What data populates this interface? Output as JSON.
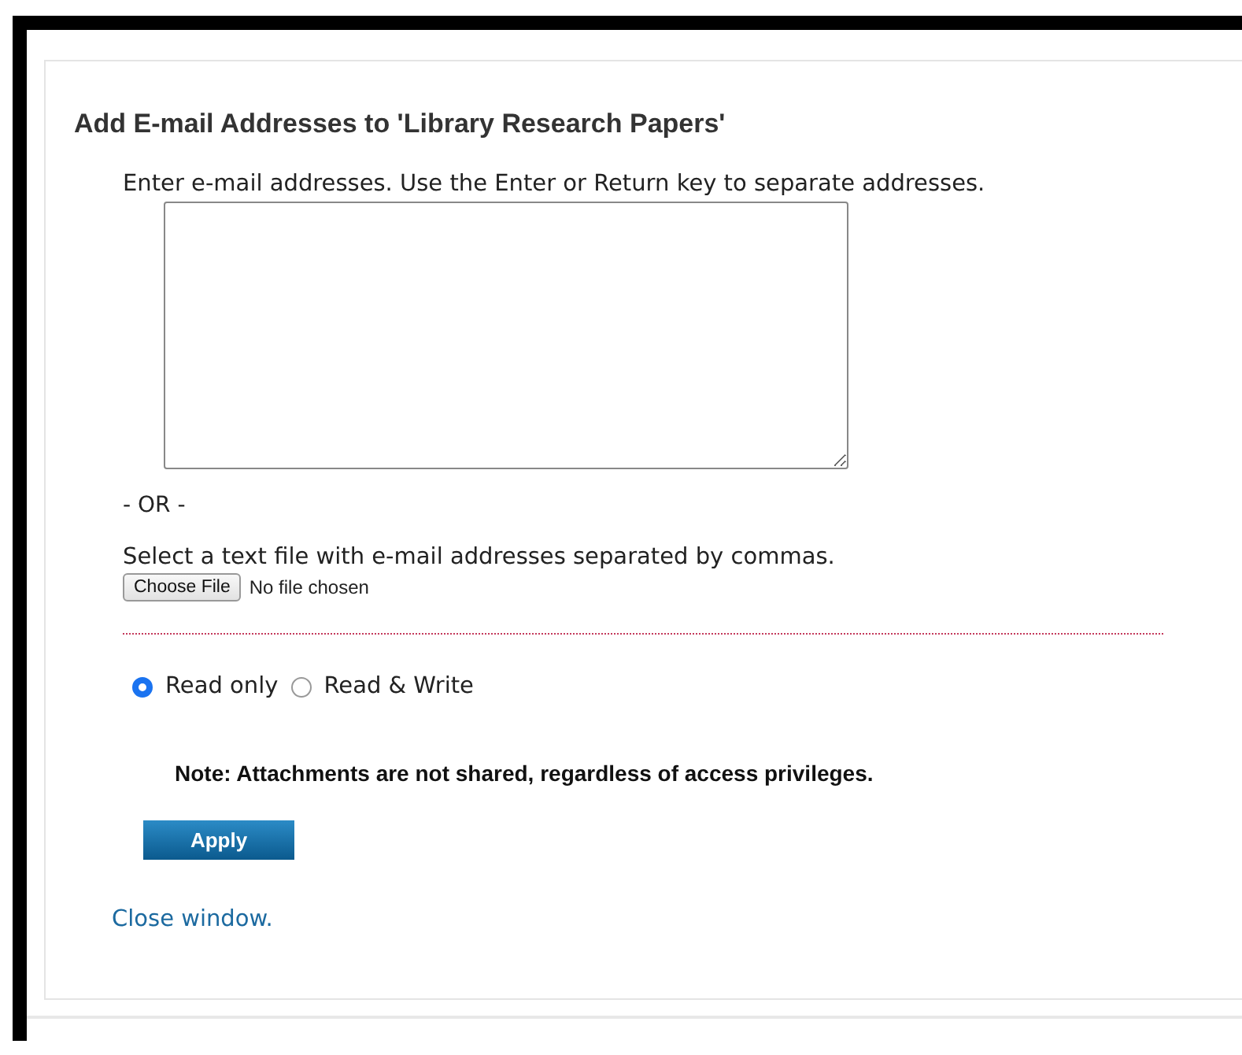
{
  "dialog": {
    "title": "Add E-mail Addresses to 'Library Research Papers'",
    "instructions": "Enter e-mail addresses. Use the Enter or Return key to separate addresses.",
    "separator": "- OR -",
    "file_prompt": "Select a text file with e-mail addresses separated by commas.",
    "file_button": "Choose File",
    "file_status": "No file chosen",
    "access_options": [
      {
        "label": "Read only",
        "selected": true
      },
      {
        "label": "Read & Write",
        "selected": false
      }
    ],
    "note": "Note: Attachments are not shared, regardless of access privileges.",
    "apply_button": "Apply",
    "close_link": "Close window."
  }
}
